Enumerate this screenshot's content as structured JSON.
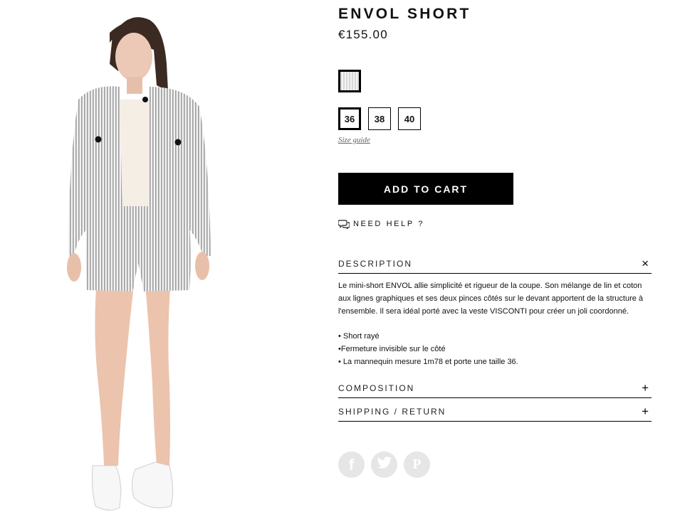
{
  "product": {
    "title": "ENVOL SHORT",
    "price": "€155.00",
    "image_alt": "Model wearing striped jacket and striped shorts"
  },
  "swatch": {
    "selected": true
  },
  "sizes": [
    "36",
    "38",
    "40"
  ],
  "selected_size": "36",
  "size_guide_label": "Size guide",
  "cart": {
    "label": "ADD TO CART"
  },
  "help": {
    "label": "NEED HELP ?",
    "icon": "chat-bubbles-icon"
  },
  "accordion": {
    "description": {
      "label": "DESCRIPTION",
      "toggle": "×",
      "text": "Le mini-short ENVOL allie simplicité et rigueur de la coupe. Son mélange de lin et coton aux lignes graphiques et ses deux pinces côtés sur le devant apportent de la structure à l'ensemble. Il sera idéal porté avec la veste VISCONTI pour créer un joli coordonné.",
      "bullets": [
        "• Short rayé",
        "•Fermeture invisible sur le côté",
        "• La mannequin mesure 1m78 et porte une taille 36."
      ]
    },
    "composition": {
      "label": "COMPOSITION",
      "toggle": "+"
    },
    "shipping": {
      "label": "SHIPPING / RETURN",
      "toggle": "+"
    }
  },
  "social": {
    "facebook": "f",
    "twitter": "twitter-bird-icon",
    "pinterest": "P"
  }
}
